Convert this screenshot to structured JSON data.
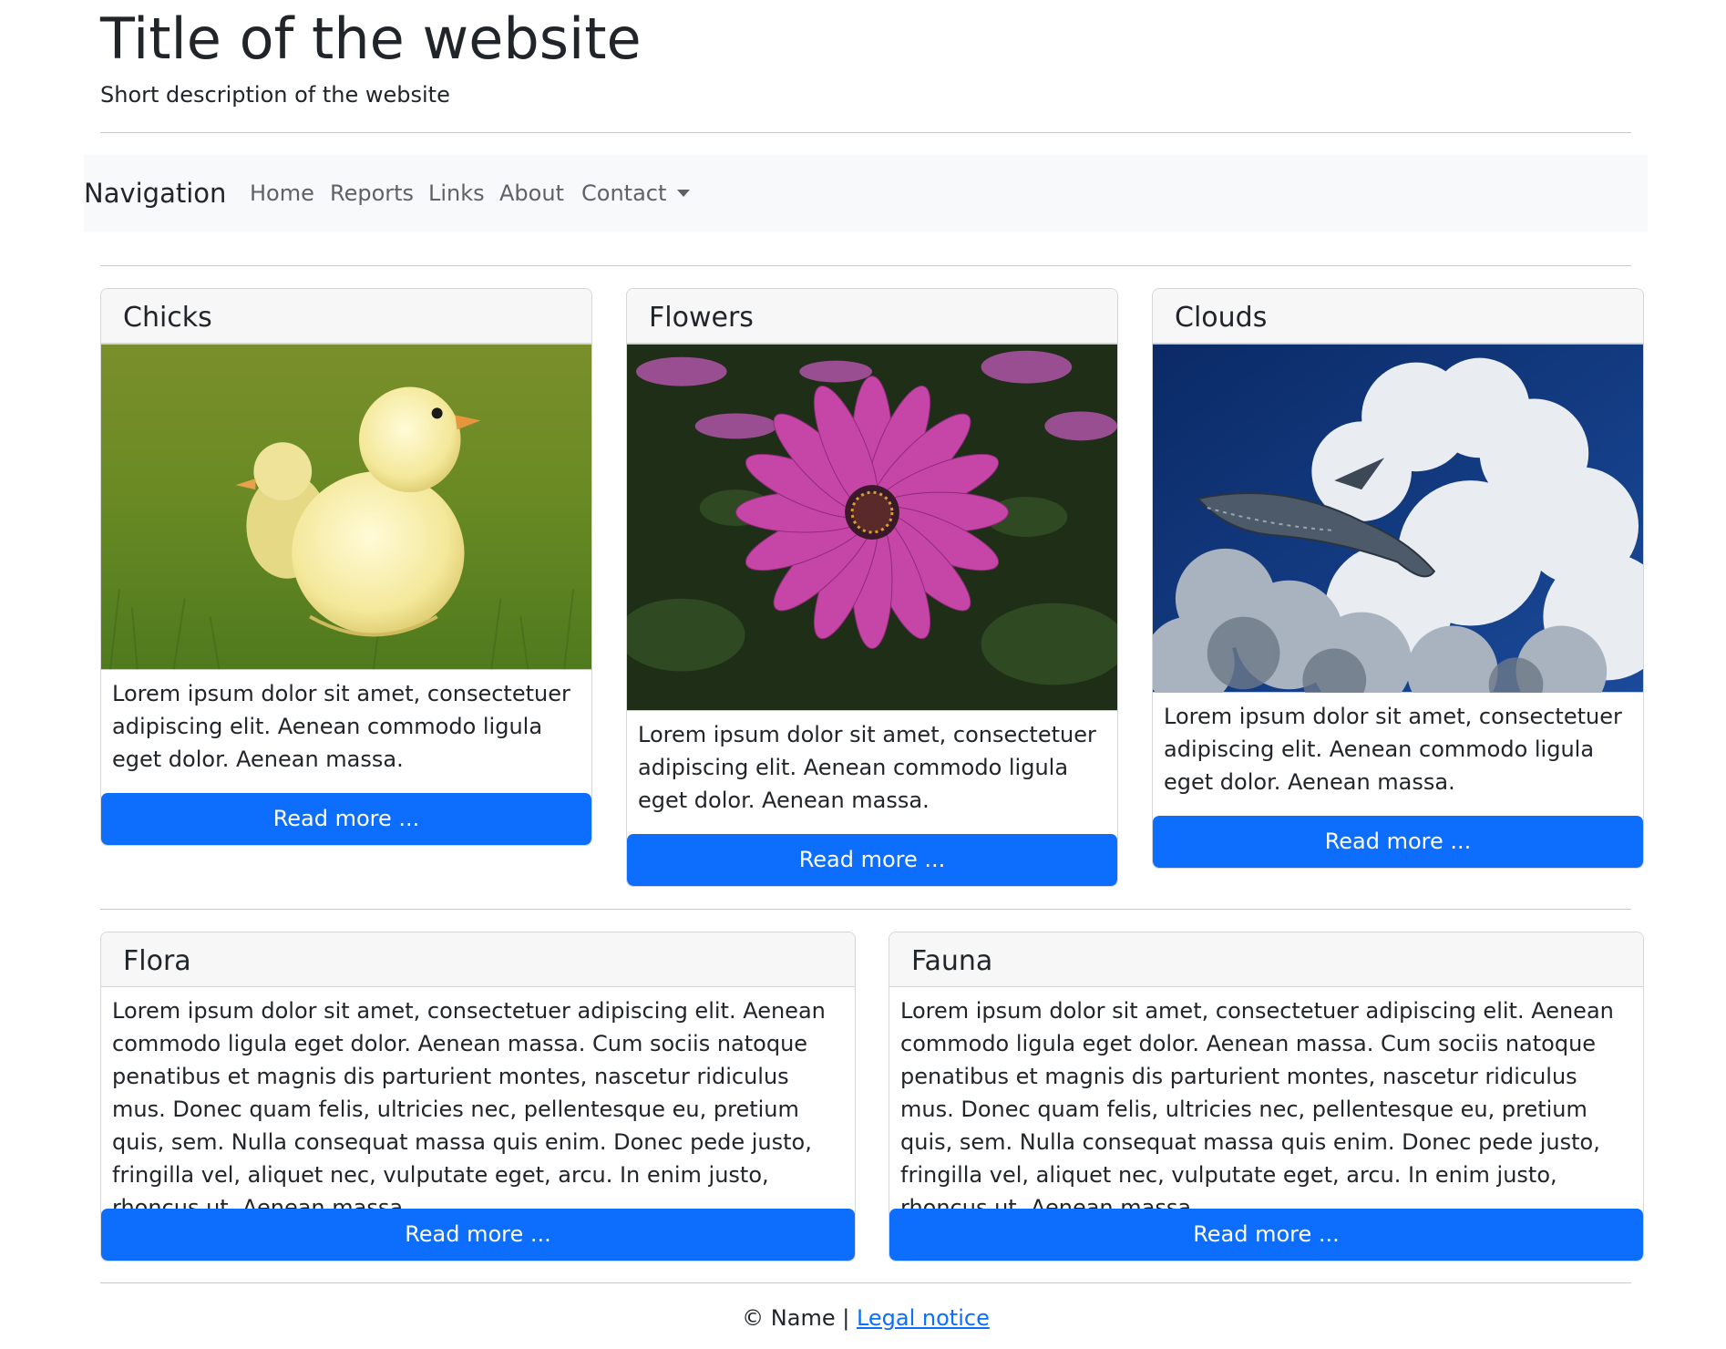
{
  "header": {
    "title": "Title of the website",
    "description": "Short description of the website"
  },
  "navbar": {
    "brand": "Navigation",
    "links": [
      {
        "label": "Home"
      },
      {
        "label": "Reports"
      },
      {
        "label": "Links"
      },
      {
        "label": "About"
      },
      {
        "label": "Contact",
        "dropdown": true
      }
    ]
  },
  "cards_top": [
    {
      "title": "Chicks",
      "image": "chicks-image",
      "text": "Lorem ipsum dolor sit amet, consectetuer adipiscing elit. Aenean commodo ligula eget dolor. Aenean massa.",
      "button": "Read more ..."
    },
    {
      "title": "Flowers",
      "image": "flower-image",
      "text": "Lorem ipsum dolor sit amet, consectetuer adipiscing elit. Aenean commodo ligula eget dolor. Aenean massa.",
      "button": "Read more ..."
    },
    {
      "title": "Clouds",
      "image": "whale-clouds-image",
      "text": "Lorem ipsum dolor sit amet, consectetuer adipiscing elit. Aenean commodo ligula eget dolor. Aenean massa.",
      "button": "Read more ..."
    }
  ],
  "cards_bottom": [
    {
      "title": "Flora",
      "text": "Lorem ipsum dolor sit amet, consectetuer adipiscing elit. Aenean commodo ligula eget dolor. Aenean massa. Cum sociis natoque penatibus et magnis dis parturient montes, nascetur ridiculus mus. Donec quam felis, ultricies nec, pellentesque eu, pretium quis, sem. Nulla consequat massa quis enim. Donec pede justo, fringilla vel, aliquet nec, vulputate eget, arcu. In enim justo, rhoncus ut. Aenean massa.",
      "button": "Read more ..."
    },
    {
      "title": "Fauna",
      "text": "Lorem ipsum dolor sit amet, consectetuer adipiscing elit. Aenean commodo ligula eget dolor. Aenean massa. Cum sociis natoque penatibus et magnis dis parturient montes, nascetur ridiculus mus. Donec quam felis, ultricies nec, pellentesque eu, pretium quis, sem. Nulla consequat massa quis enim. Donec pede justo, fringilla vel, aliquet nec, vulputate eget, arcu. In enim justo, rhoncus ut. Aenean massa.",
      "button": "Read more ..."
    }
  ],
  "footer": {
    "copyright": "© Name |",
    "legal_link": "Legal notice"
  },
  "colors": {
    "primary": "#0d6efd",
    "navbar_bg": "#f8f9fa",
    "card_header_bg": "#f7f7f7"
  }
}
